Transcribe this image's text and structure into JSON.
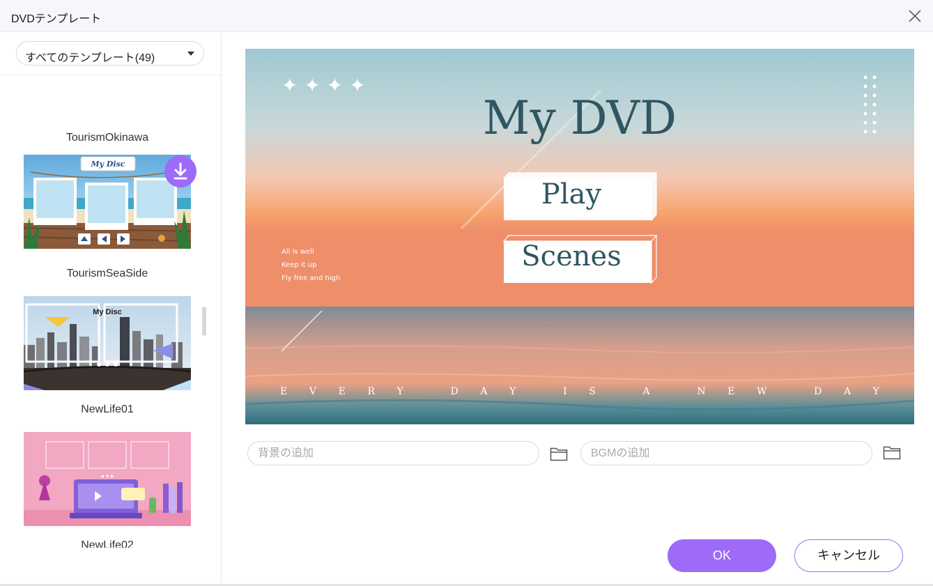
{
  "window": {
    "title": "DVDテンプレート"
  },
  "sidebar": {
    "dropdown_label": "すべてのテンプレート(49)",
    "items": [
      {
        "label": "TourismOkinawa"
      },
      {
        "label": "TourismSeaSide",
        "thumb_title": "My Disc"
      },
      {
        "label": "NewLife01",
        "thumb_title": "My Disc"
      },
      {
        "label": "NewLife02"
      }
    ]
  },
  "preview": {
    "title": "My DVD",
    "play_label": "Play",
    "scenes_label": "Scenes",
    "side_text": [
      "All is well",
      "Keep it up",
      "Fly free and high"
    ],
    "footer_text": "E V E R Y   D A Y   I S   A   N E W   D A Y",
    "stars": "✦ ✦ ✦ ✦"
  },
  "inputs": {
    "background_placeholder": "背景の追加",
    "bgm_placeholder": "BGMの追加"
  },
  "buttons": {
    "ok": "OK",
    "cancel": "キャンセル"
  },
  "colors": {
    "accent": "#9d6bf8",
    "title_text": "#2f5662"
  }
}
